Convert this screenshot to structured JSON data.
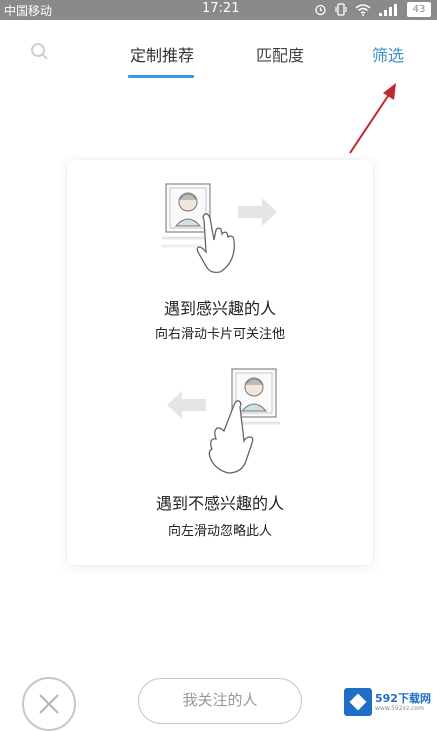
{
  "status_bar": {
    "carrier": "中国移动",
    "time": "17:21",
    "battery": "43"
  },
  "nav": {
    "tabs": [
      {
        "label": "定制推荐",
        "active": true
      },
      {
        "label": "匹配度",
        "active": false
      }
    ],
    "filter_label": "筛选"
  },
  "card": {
    "swipe_right_title": "遇到感兴趣的人",
    "swipe_right_hint": "向右滑动卡片可关注他",
    "swipe_left_title": "遇到不感兴趣的人",
    "swipe_left_hint": "向左滑动忽略此人"
  },
  "bottom": {
    "follow_label": "我关注的人"
  },
  "watermark": {
    "text": "592下载网",
    "sub": "www.592xz.com"
  },
  "colors": {
    "accent": "#3a9bd5",
    "annotation": "#c0282d",
    "statusbar": "#8a8a8a"
  }
}
